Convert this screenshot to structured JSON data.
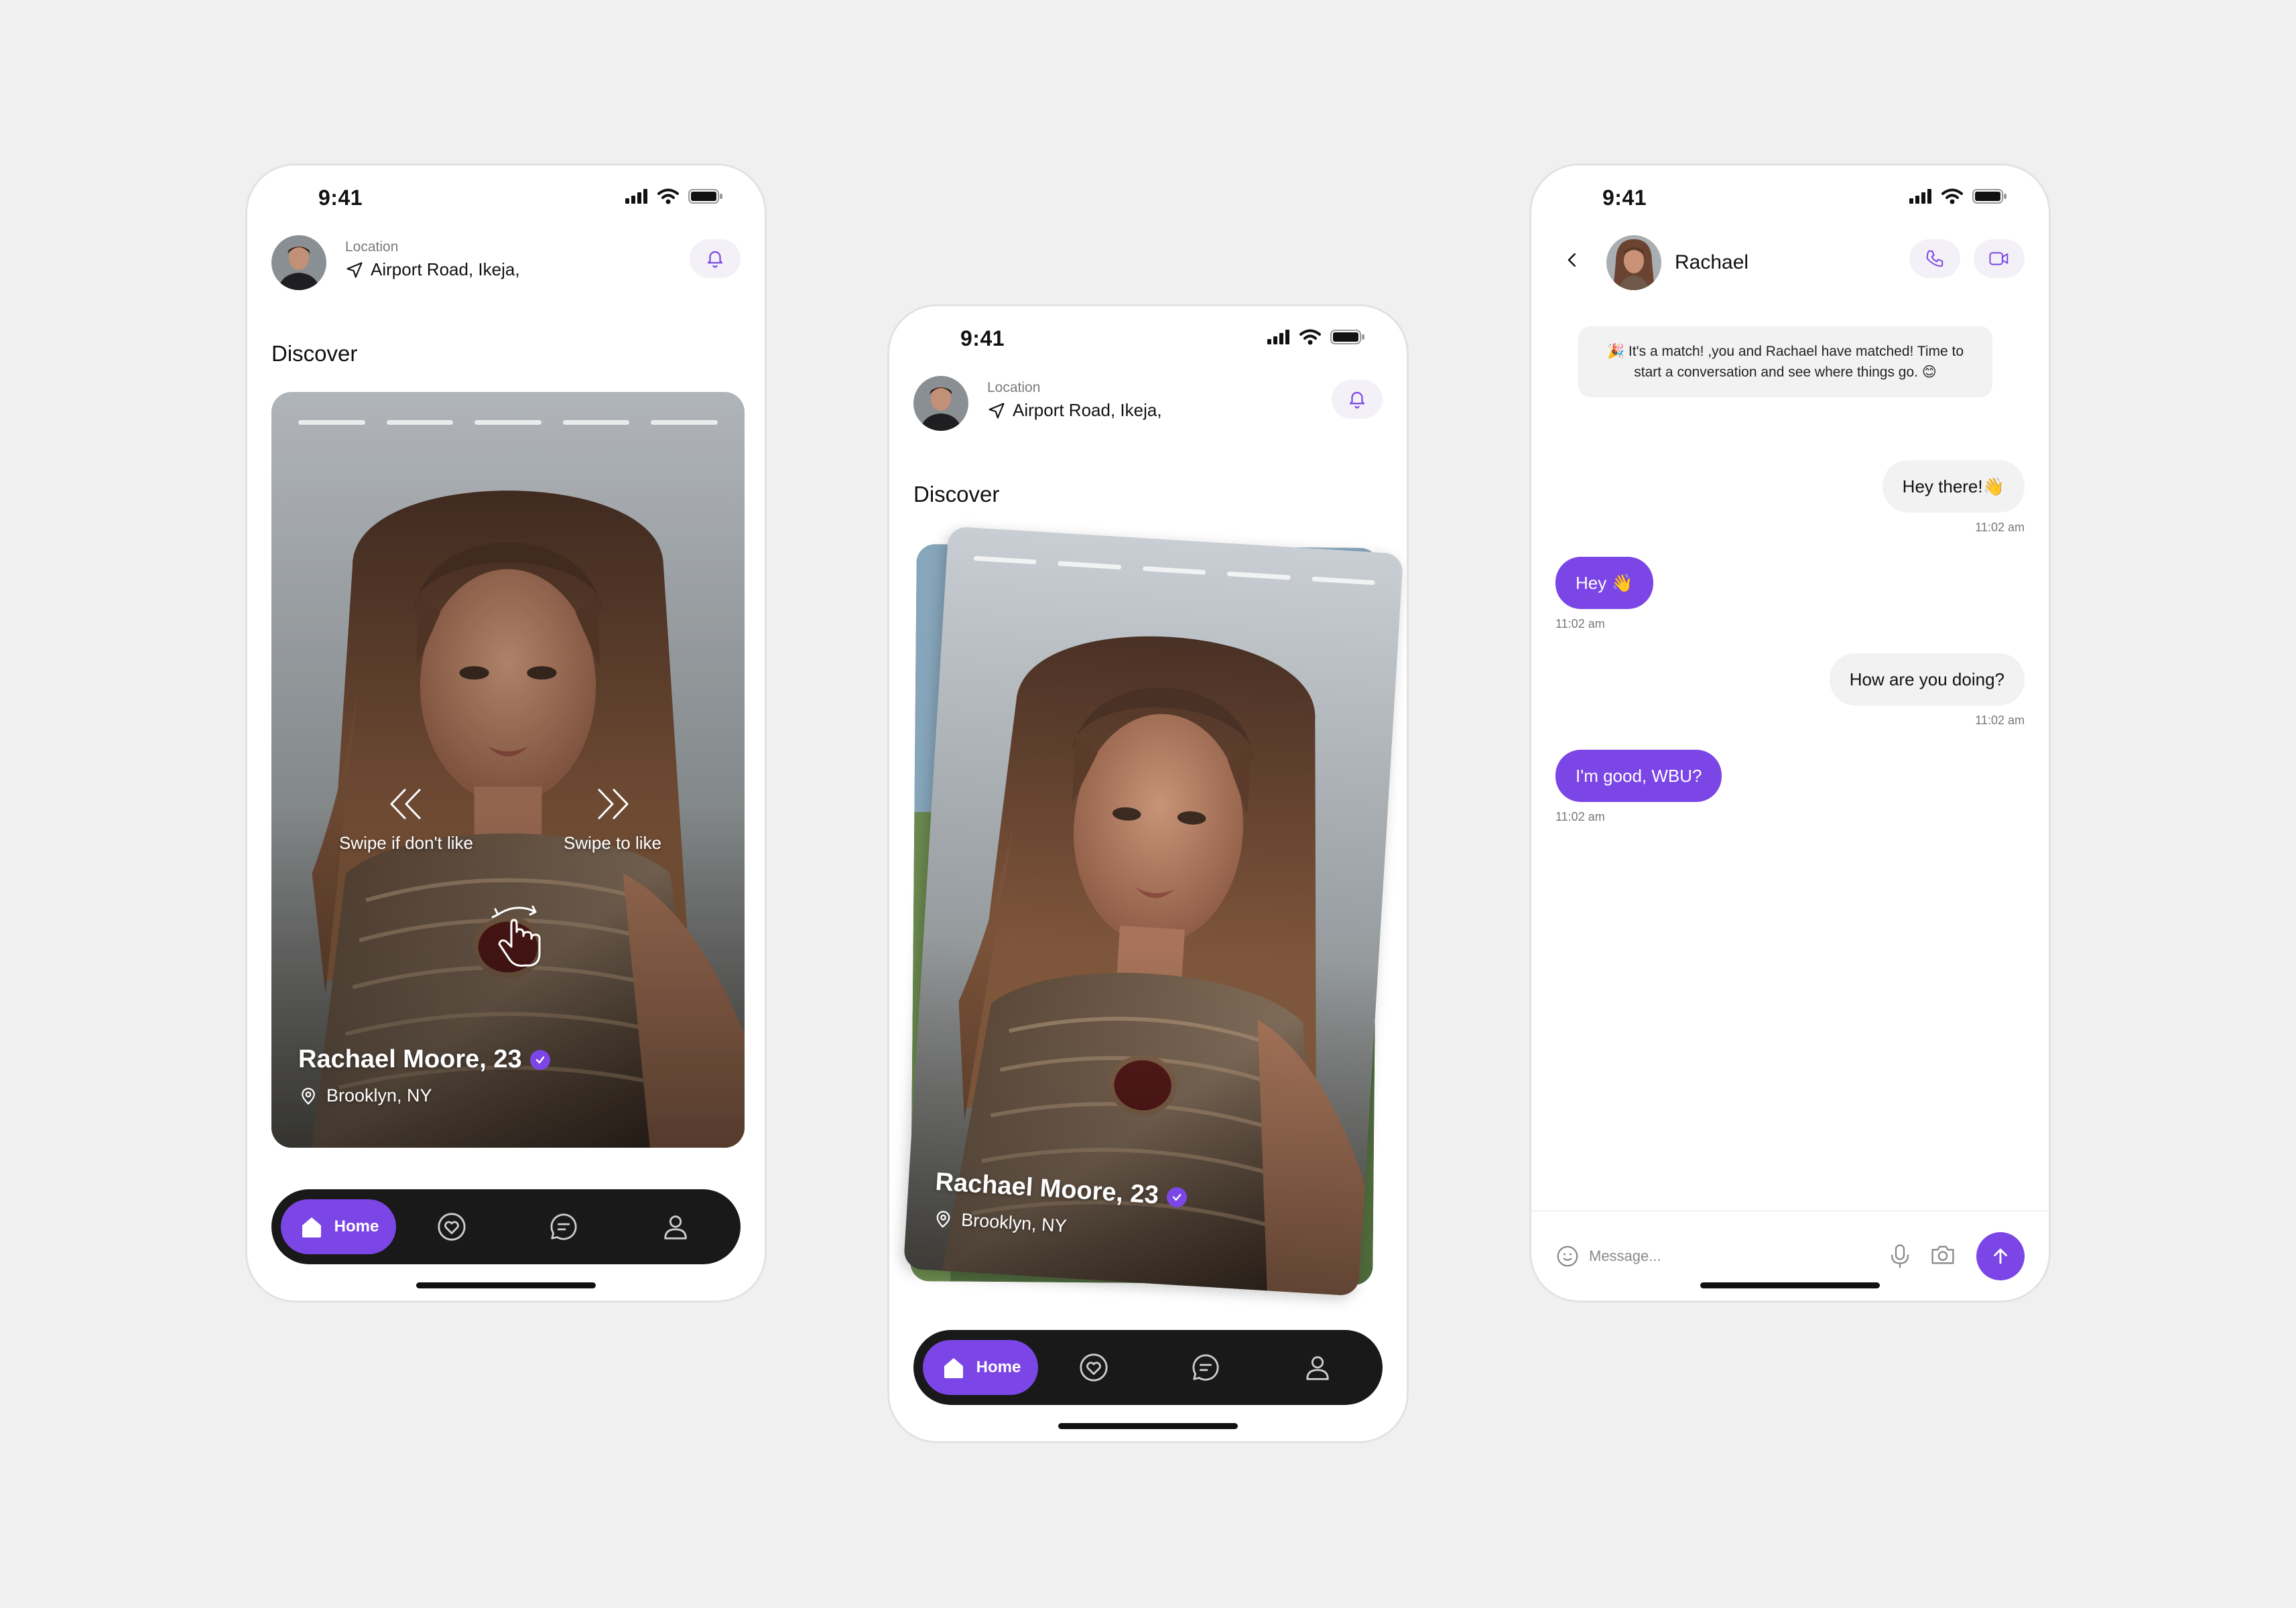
{
  "colors": {
    "accent": "#7C46E6",
    "nav_bg": "#191919",
    "bubble_in": "#7C46E6",
    "bubble_out": "#F2F2F2",
    "background": "#F0F0F0"
  },
  "status": {
    "time": "9:41"
  },
  "header": {
    "location_label": "Location",
    "location_value": "Airport Road, Ikeja,"
  },
  "discover": {
    "title": "Discover"
  },
  "profile_card": {
    "name": "Rachael Moore, 23",
    "location": "Brooklyn, NY",
    "photo_count": 5,
    "swipe_left_label": "Swipe if don't like",
    "swipe_right_label": "Swipe to like"
  },
  "nav": {
    "home_label": "Home",
    "items": [
      {
        "icon": "heart-icon"
      },
      {
        "icon": "chat-icon"
      },
      {
        "icon": "profile-icon"
      }
    ]
  },
  "chat": {
    "name": "Rachael",
    "match_note": "🎉 It's a match! ,you and Rachael have matched! Time to start a conversation and see where things go. 😊",
    "messages": [
      {
        "dir": "out",
        "text": "Hey there!👋",
        "time": "11:02 am"
      },
      {
        "dir": "in",
        "text": "Hey 👋",
        "time": "11:02 am"
      },
      {
        "dir": "out",
        "text": "How are you doing?",
        "time": "11:02 am"
      },
      {
        "dir": "in",
        "text": "I'm good, WBU?",
        "time": "11:02 am"
      }
    ],
    "input_placeholder": "Message..."
  }
}
